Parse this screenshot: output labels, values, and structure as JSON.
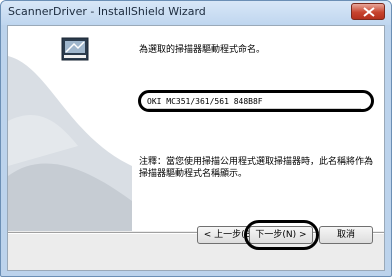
{
  "window": {
    "title": "ScannerDriver - InstallShield Wizard"
  },
  "main": {
    "prompt": "為選取的掃描器驅動程式命名。",
    "scanner_name_value": "OKI MC351/361/561 848B8F",
    "note": "注釋：當您使用掃描公用程式選取掃描器時，此名稱將作為掃描器驅動程式名稱顯示。"
  },
  "buttons": {
    "back_label": "< 上一步(B)",
    "next_label": "下一步(N) >",
    "cancel_label": "取消"
  },
  "icons": {
    "close": "close-icon",
    "installer": "scanner-installer-icon"
  },
  "colors": {
    "titlebar": "#bfd6ef",
    "banner_background": "#ffffff",
    "close_button": "#c8452f",
    "highlight_ring": "#000000"
  }
}
